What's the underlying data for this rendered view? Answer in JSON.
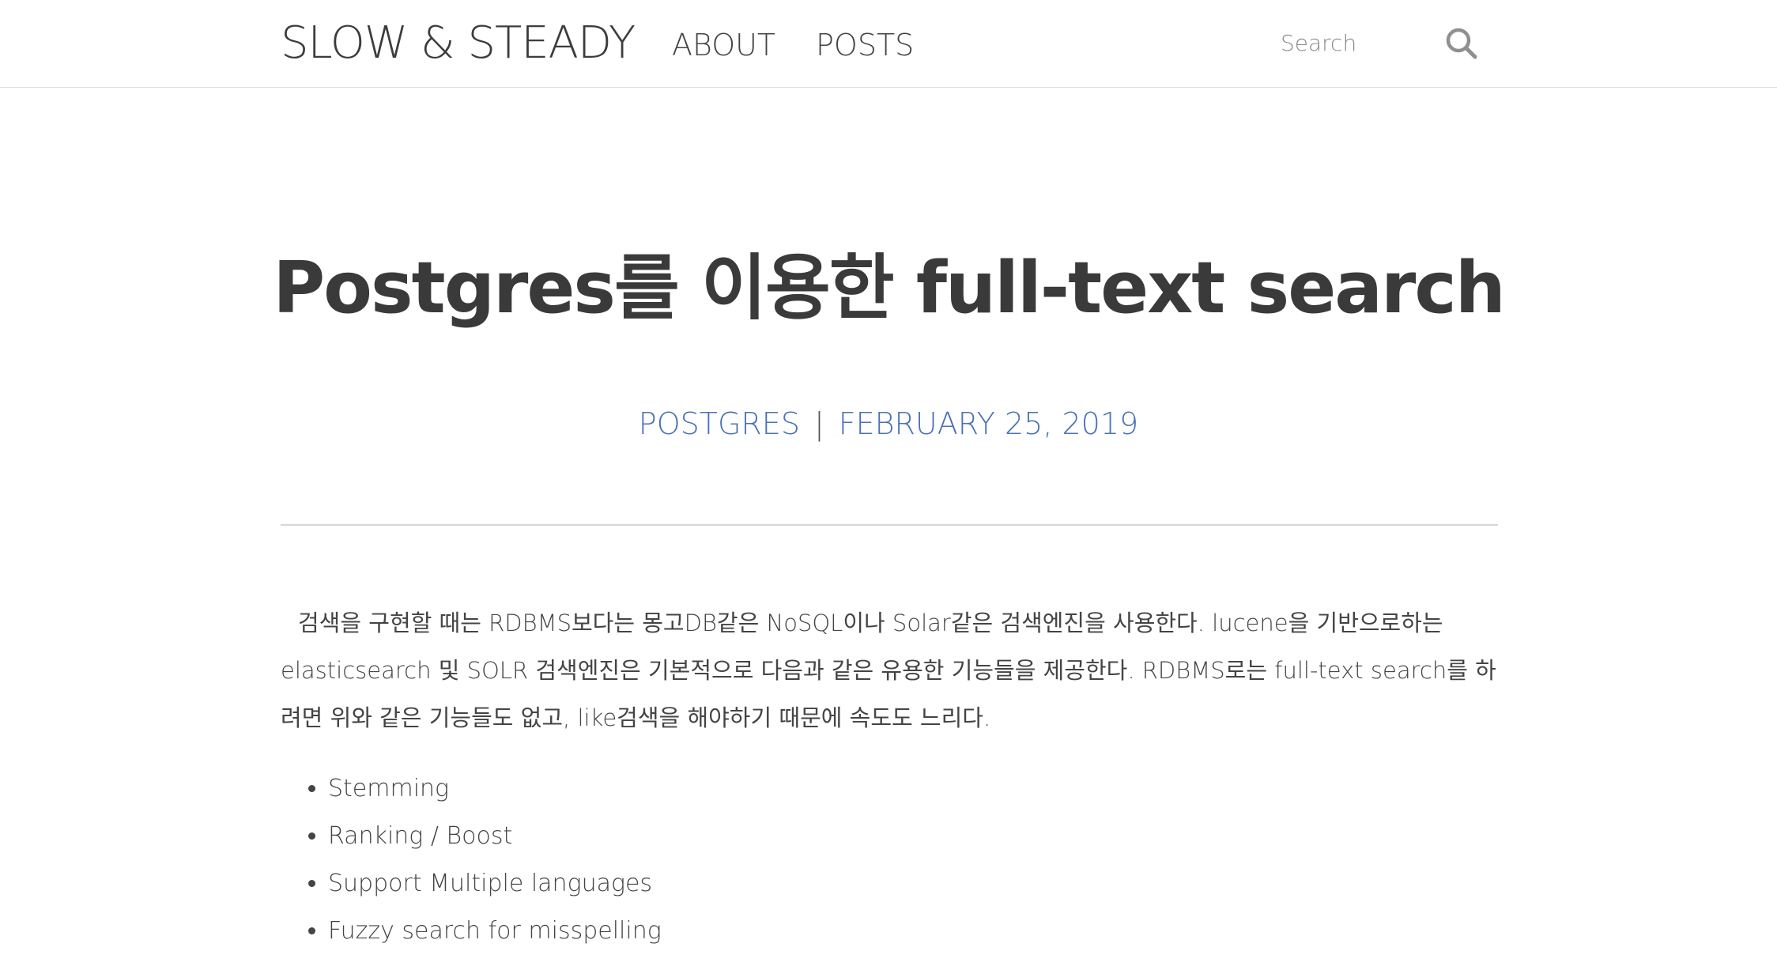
{
  "header": {
    "brand": "SLOW & STEADY",
    "nav": [
      "ABOUT",
      "POSTS"
    ],
    "search_placeholder": "Search"
  },
  "post": {
    "title": "Postgres를 이용한 full-text search",
    "category": "POSTGRES",
    "separator": "|",
    "date": "FEBRUARY 25, 2019",
    "intro": "검색을 구현할 때는 RDBMS보다는 몽고DB같은 NoSQL이나 Solar같은 검색엔진을 사용한다. lucene을 기반으로하는 elasticsearch 및 SOLR 검색엔진은 기본적으로 다음과 같은 유용한 기능들을 제공한다. RDBMS로는 full-text search를 하려면 위와 같은 기능들도 없고, like검색을 해야하기 때문에 속도도 느리다.",
    "features": [
      "Stemming",
      "Ranking / Boost",
      "Support Multiple languages",
      "Fuzzy search for misspelling"
    ]
  },
  "colors": {
    "accent": "#4a72b8",
    "text": "#3a3a3a",
    "divider": "#d6d6d6"
  },
  "icons": {
    "search": "search-icon"
  }
}
